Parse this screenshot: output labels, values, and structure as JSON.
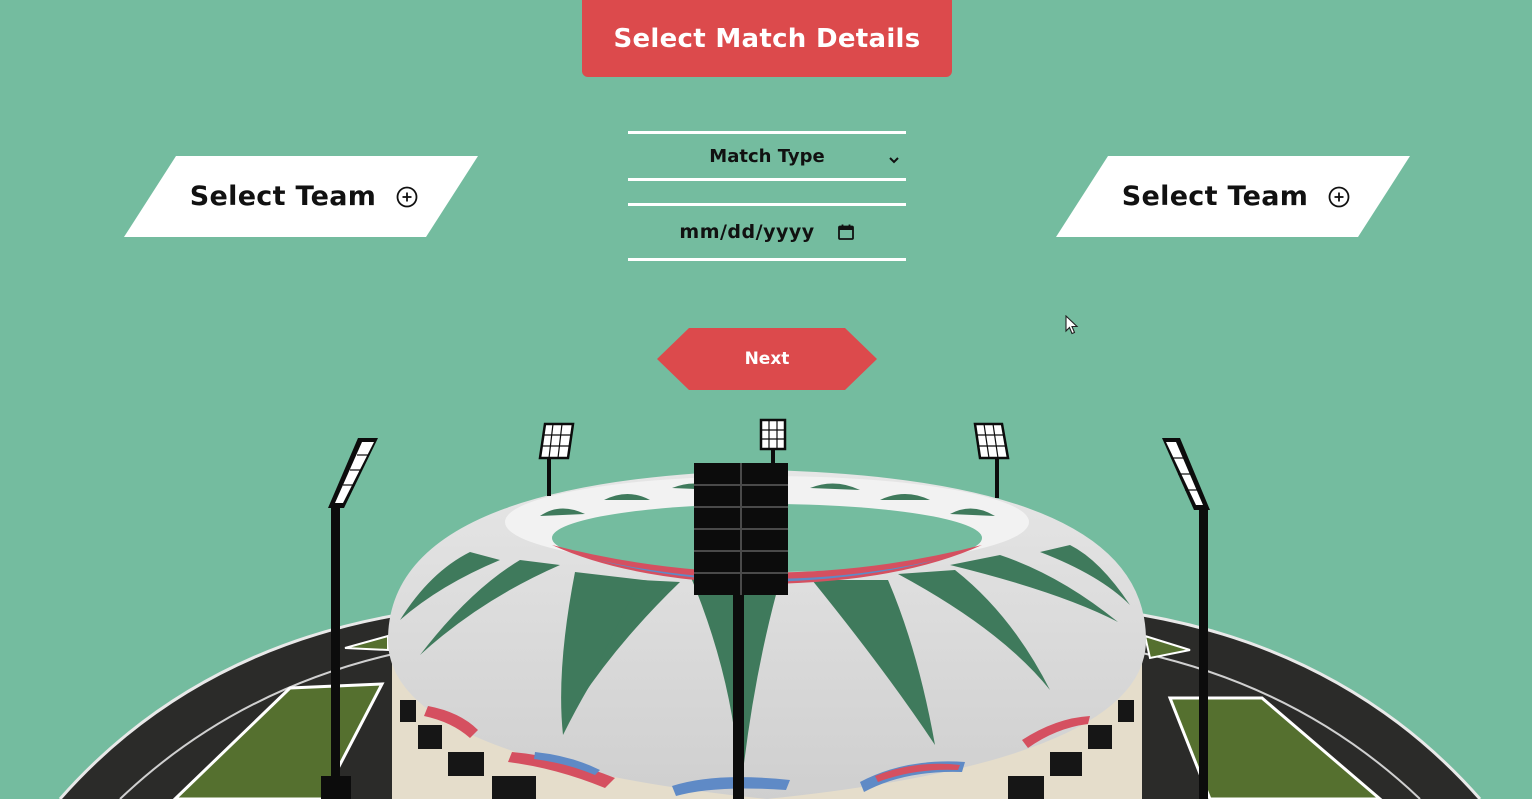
{
  "header": {
    "title": "Select Match Details"
  },
  "teams": {
    "left": {
      "label": "Select Team",
      "icon": "plus-circle-icon"
    },
    "right": {
      "label": "Select Team",
      "icon": "plus-circle-icon"
    }
  },
  "form": {
    "match_type": {
      "value": "Match Type",
      "icon": "chevron-down-icon"
    },
    "match_date": {
      "value": "mm/dd/yyyy",
      "icon": "calendar-icon"
    }
  },
  "actions": {
    "next_label": "Next"
  },
  "colors": {
    "background": "#74bc9f",
    "accent": "#dc4a4c",
    "panel": "#ffffff",
    "text": "#111111"
  }
}
